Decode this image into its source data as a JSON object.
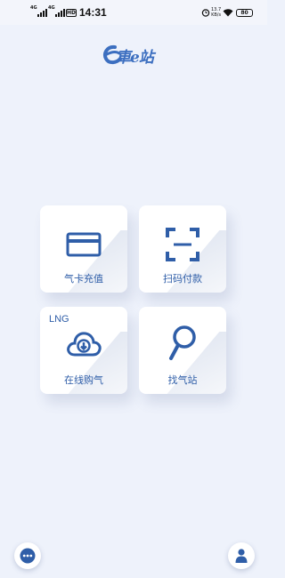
{
  "status_bar": {
    "time": "14:31",
    "net1": "4G",
    "net2": "4G",
    "hd": "HD",
    "speed_value": "13.7",
    "speed_unit": "KB/s",
    "battery": "80"
  },
  "header": {
    "logo_text": "車e站"
  },
  "tiles": [
    {
      "label": "气卡充值",
      "icon": "card-icon"
    },
    {
      "label": "扫码付款",
      "icon": "scan-icon"
    },
    {
      "label": "在线购气",
      "icon": "cloud-download-icon",
      "tag": "LNG"
    },
    {
      "label": "找气站",
      "icon": "search-icon"
    }
  ],
  "colors": {
    "background": "#eef2fb",
    "accent": "#2f5ea8",
    "tile": "#ffffff"
  }
}
